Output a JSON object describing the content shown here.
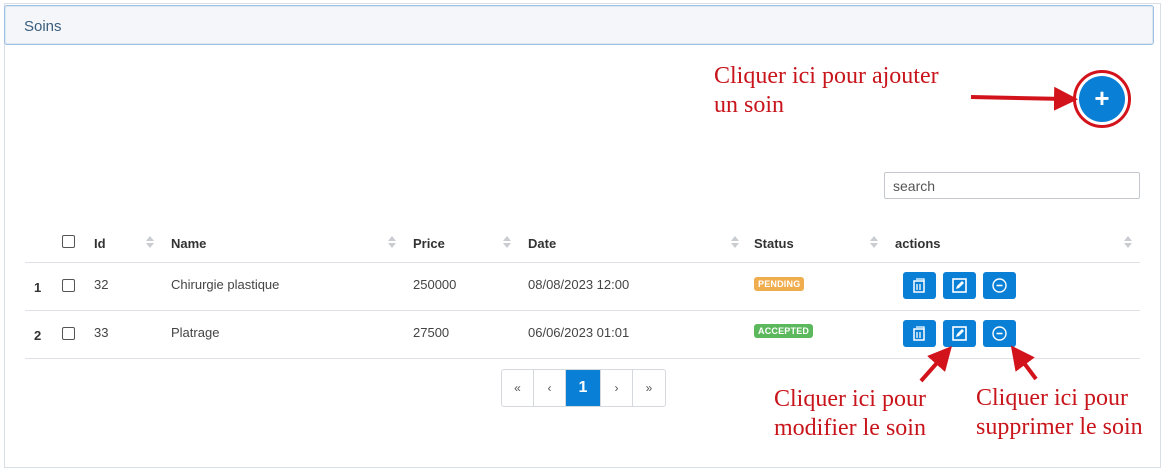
{
  "panel": {
    "title": "Soins"
  },
  "add_button": {
    "label": "+"
  },
  "annotations": {
    "add": "Cliquer ici pour ajouter\nun soin",
    "modify": "Cliquer ici pour\nmodifier le soin",
    "delete": "Cliquer ici pour\nsupprimer le soin"
  },
  "search": {
    "placeholder": "search"
  },
  "table": {
    "headers": {
      "id": "Id",
      "name": "Name",
      "price": "Price",
      "date": "Date",
      "status": "Status",
      "actions": "actions"
    },
    "rows": [
      {
        "num": "1",
        "id": "32",
        "name": "Chirurgie plastique",
        "price": "250000",
        "date": "08/08/2023 12:00",
        "status": "PENDING",
        "status_color": "#f0ad4e"
      },
      {
        "num": "2",
        "id": "33",
        "name": "Platrage",
        "price": "27500",
        "date": "06/06/2023 01:01",
        "status": "ACCEPTED",
        "status_color": "#5cb85c"
      }
    ]
  },
  "pagination": {
    "first": "«",
    "prev": "‹",
    "current": "1",
    "next": "›",
    "last": "»"
  },
  "colors": {
    "primary": "#0a7fd6",
    "annotation": "#c8141b"
  }
}
